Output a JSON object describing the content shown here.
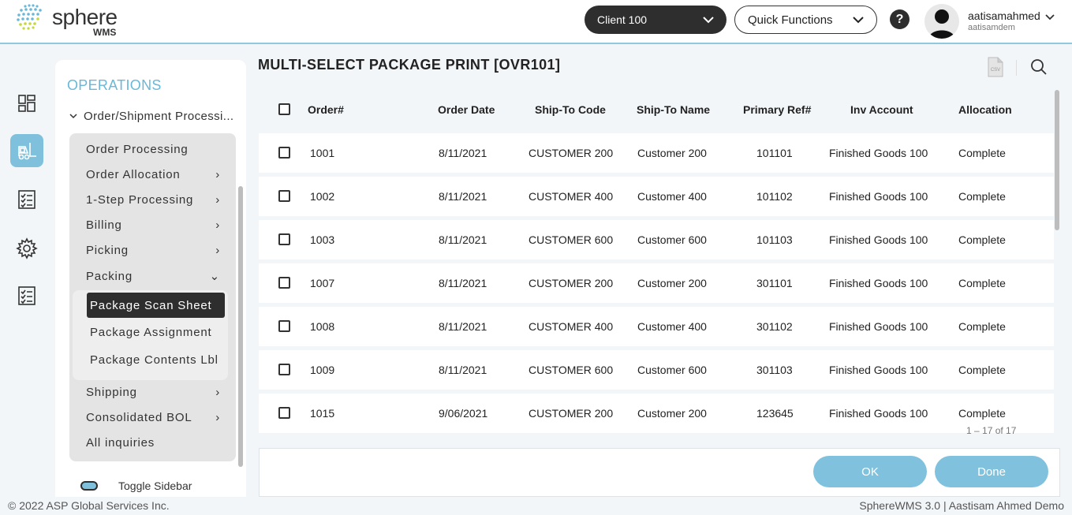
{
  "header": {
    "logo_text": "sphere",
    "logo_sub": "WMS",
    "client_select": "Client 100",
    "quick_functions": "Quick Functions",
    "help": "?",
    "user_name": "aatisamahmed",
    "user_sub": "aatisamdem"
  },
  "sidebar": {
    "title": "OPERATIONS",
    "section": "Order/Shipment Processi...",
    "items": [
      {
        "label": "Order Processing",
        "chevron": ""
      },
      {
        "label": "Order Allocation",
        "chevron": "›"
      },
      {
        "label": "1-Step Processing",
        "chevron": "›"
      },
      {
        "label": "Billing",
        "chevron": "›"
      },
      {
        "label": "Picking",
        "chevron": "›"
      },
      {
        "label": "Packing",
        "chevron": "⌄"
      }
    ],
    "sub_items": [
      {
        "label": "Package Scan Sheet",
        "active": true
      },
      {
        "label": "Package Assignment",
        "active": false
      },
      {
        "label": "Package Contents Lbl",
        "active": false
      }
    ],
    "items_after": [
      {
        "label": "Shipping",
        "chevron": "›"
      },
      {
        "label": "Consolidated BOL",
        "chevron": "›"
      },
      {
        "label": "All inquiries",
        "chevron": ""
      }
    ],
    "toggle_label": "Toggle Sidebar"
  },
  "main": {
    "title": "MULTI-SELECT PACKAGE PRINT [OVR101]",
    "csv_label": "CSV",
    "columns": [
      "Order#",
      "Order Date",
      "Ship-To Code",
      "Ship-To Name",
      "Primary Ref#",
      "Inv Account",
      "Allocation"
    ],
    "rows": [
      [
        "1001",
        "8/11/2021",
        "CUSTOMER 200",
        "Customer 200",
        "101101",
        "Finished Goods 100",
        "Complete"
      ],
      [
        "1002",
        "8/11/2021",
        "CUSTOMER 400",
        "Customer 400",
        "101102",
        "Finished Goods 100",
        "Complete"
      ],
      [
        "1003",
        "8/11/2021",
        "CUSTOMER 600",
        "Customer 600",
        "101103",
        "Finished Goods 100",
        "Complete"
      ],
      [
        "1007",
        "8/11/2021",
        "CUSTOMER 200",
        "Customer 200",
        "301101",
        "Finished Goods 100",
        "Complete"
      ],
      [
        "1008",
        "8/11/2021",
        "CUSTOMER 400",
        "Customer 400",
        "301102",
        "Finished Goods 100",
        "Complete"
      ],
      [
        "1009",
        "8/11/2021",
        "CUSTOMER 600",
        "Customer 600",
        "301103",
        "Finished Goods 100",
        "Complete"
      ],
      [
        "1015",
        "9/06/2021",
        "CUSTOMER 200",
        "Customer 200",
        "123645",
        "Finished Goods 100",
        "Complete"
      ]
    ],
    "pager": "1 – 17 of 17",
    "ok_label": "OK",
    "done_label": "Done"
  },
  "footer": {
    "copyright": "© 2022 ASP Global Services Inc.",
    "version": "SphereWMS 3.0 | Aastisam Ahmed Demo"
  },
  "colors": {
    "accent": "#7fc1dc",
    "dark": "#2e2e2e",
    "title_blue": "#6ab8d8"
  }
}
